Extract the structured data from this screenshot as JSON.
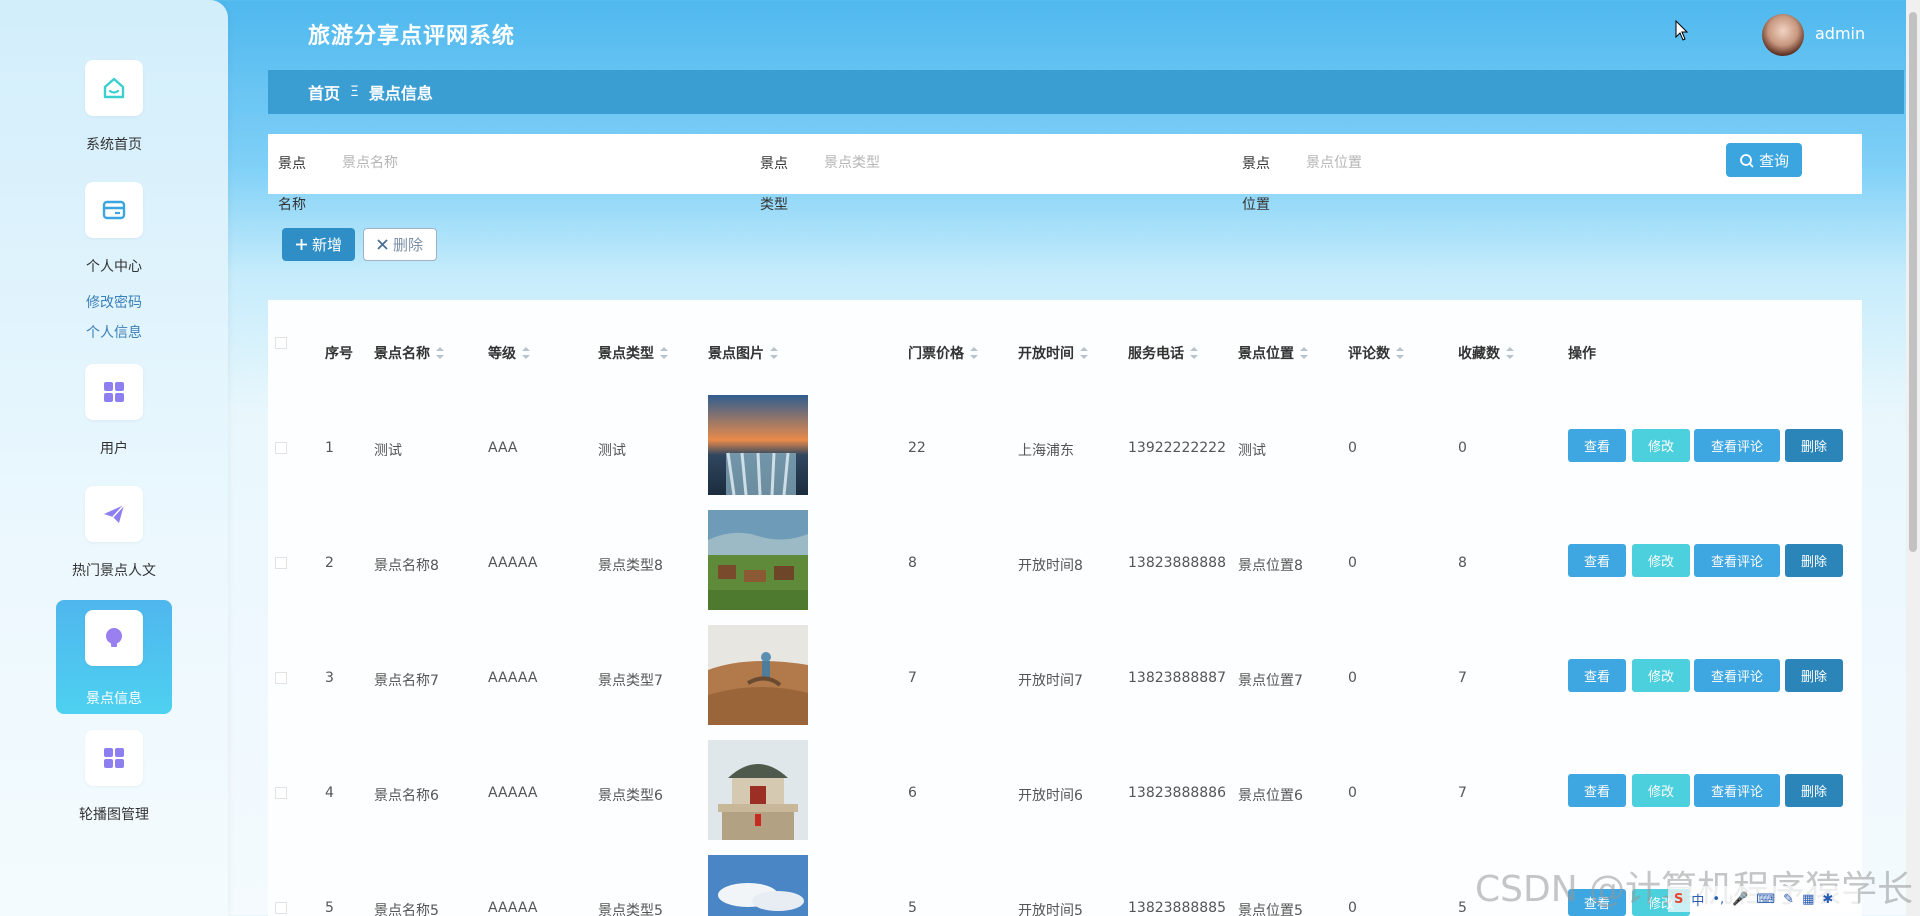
{
  "app": {
    "title": "旅游分享点评网系统"
  },
  "user": {
    "name": "admin"
  },
  "sidebar": {
    "items": [
      {
        "label": "系统首页",
        "icon": "home-icon"
      },
      {
        "label": "个人中心",
        "icon": "card-icon"
      },
      {
        "label": "用户",
        "icon": "grid-icon"
      },
      {
        "label": "热门景点人文",
        "icon": "send-icon"
      },
      {
        "label": "景点信息",
        "icon": "bulb-icon"
      },
      {
        "label": "轮播图管理",
        "icon": "grid-icon"
      }
    ],
    "sub_links": [
      "修改密码",
      "个人信息"
    ],
    "active_index": 4,
    "accent": "#4fb6ee"
  },
  "breadcrumb": {
    "home": "首页",
    "separator": "Ξ",
    "current": "景点信息"
  },
  "search": {
    "fields": [
      {
        "label_top": "景点",
        "label_bottom": "名称",
        "placeholder": "景点名称",
        "value": ""
      },
      {
        "label_top": "景点",
        "label_bottom": "类型",
        "placeholder": "景点类型",
        "value": ""
      },
      {
        "label_top": "景点",
        "label_bottom": "位置",
        "placeholder": "景点位置",
        "value": ""
      }
    ],
    "button_label": "查询"
  },
  "actions": {
    "add_label": "新增",
    "delete_label": "删除"
  },
  "table": {
    "columns": [
      "序号",
      "景点名称",
      "等级",
      "景点类型",
      "景点图片",
      "门票价格",
      "开放时间",
      "服务电话",
      "景点位置",
      "评论数",
      "收藏数",
      "操作"
    ],
    "row_buttons": {
      "view": "查看",
      "edit": "修改",
      "reviews": "查看评论",
      "delete": "删除"
    },
    "rows": [
      {
        "index": "1",
        "name": "测试",
        "grade": "AAA",
        "type": "测试",
        "price": "22",
        "open_time": "上海浦东",
        "phone": "13922222222",
        "location": "测试",
        "comments": "0",
        "favorites": "0"
      },
      {
        "index": "2",
        "name": "景点名称8",
        "grade": "AAAAA",
        "type": "景点类型8",
        "price": "8",
        "open_time": "开放时间8",
        "phone": "13823888888",
        "location": "景点位置8",
        "comments": "0",
        "favorites": "8"
      },
      {
        "index": "3",
        "name": "景点名称7",
        "grade": "AAAAA",
        "type": "景点类型7",
        "price": "7",
        "open_time": "开放时间7",
        "phone": "13823888887",
        "location": "景点位置7",
        "comments": "0",
        "favorites": "7"
      },
      {
        "index": "4",
        "name": "景点名称6",
        "grade": "AAAAA",
        "type": "景点类型6",
        "price": "6",
        "open_time": "开放时间6",
        "phone": "13823888886",
        "location": "景点位置6",
        "comments": "0",
        "favorites": "7"
      },
      {
        "index": "5",
        "name": "景点名称5",
        "grade": "AAAAA",
        "type": "景点类型5",
        "price": "5",
        "open_time": "开放时间5",
        "phone": "13823888885",
        "location": "景点位置5",
        "comments": "0",
        "favorites": "5"
      }
    ]
  },
  "watermark": "CSDN @计算机程序猿学长",
  "tray": {
    "ime_label": "中"
  }
}
